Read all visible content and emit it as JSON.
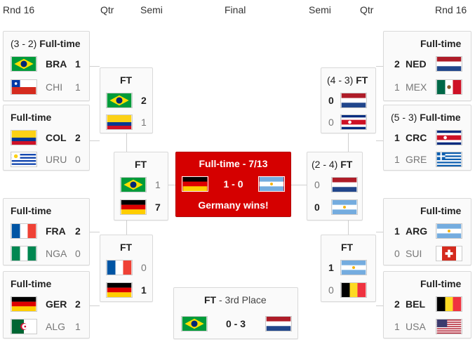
{
  "headers": {
    "rnd16_left": "Rnd 16",
    "qtr_left": "Qtr",
    "semi_left": "Semi",
    "final": "Final",
    "semi_right": "Semi",
    "qtr_right": "Qtr",
    "rnd16_right": "Rnd 16"
  },
  "left_r16": [
    {
      "pen": "(3 - 2)",
      "status": "Full-time",
      "t1": {
        "abbr": "BRA",
        "score": "1"
      },
      "t2": {
        "abbr": "CHI",
        "score": "1"
      }
    },
    {
      "pen": "",
      "status": "Full-time",
      "t1": {
        "abbr": "COL",
        "score": "2"
      },
      "t2": {
        "abbr": "URU",
        "score": "0"
      }
    },
    {
      "pen": "",
      "status": "Full-time",
      "t1": {
        "abbr": "FRA",
        "score": "2"
      },
      "t2": {
        "abbr": "NGA",
        "score": "0"
      }
    },
    {
      "pen": "",
      "status": "Full-time",
      "t1": {
        "abbr": "GER",
        "score": "2"
      },
      "t2": {
        "abbr": "ALG",
        "score": "1"
      }
    }
  ],
  "right_r16": [
    {
      "pen": "",
      "status": "Full-time",
      "t1": {
        "abbr": "NED",
        "score": "2"
      },
      "t2": {
        "abbr": "MEX",
        "score": "1"
      }
    },
    {
      "pen": "(5 - 3)",
      "status": "Full-time",
      "t1": {
        "abbr": "CRC",
        "score": "1"
      },
      "t2": {
        "abbr": "GRE",
        "score": "1"
      }
    },
    {
      "pen": "",
      "status": "Full-time",
      "t1": {
        "abbr": "ARG",
        "score": "1"
      },
      "t2": {
        "abbr": "SUI",
        "score": "0"
      }
    },
    {
      "pen": "",
      "status": "Full-time",
      "t1": {
        "abbr": "BEL",
        "score": "2"
      },
      "t2": {
        "abbr": "USA",
        "score": "1"
      }
    }
  ],
  "left_qf": [
    {
      "status": "FT",
      "s1": "2",
      "s2": "1"
    },
    {
      "status": "FT",
      "s1": "0",
      "s2": "1"
    }
  ],
  "right_qf": [
    {
      "pen": "(4 - 3)",
      "status": "FT",
      "s1": "0",
      "s2": "0"
    },
    {
      "status": "FT",
      "s1": "1",
      "s2": "0"
    }
  ],
  "left_sf": {
    "status": "FT",
    "s1": "1",
    "s2": "7"
  },
  "right_sf": {
    "pen": "(2 - 4)",
    "status": "FT",
    "s1": "0",
    "s2": "0"
  },
  "final": {
    "status": "Full-time - 7/13",
    "score": "1 - 0",
    "result": "Germany wins!"
  },
  "third": {
    "status": "FT",
    "sub": " - 3rd Place",
    "score": "0 - 3"
  },
  "colors": {
    "final_red": "#d50000",
    "box_bg": "#fafafa",
    "border": "#d9d9d9"
  }
}
